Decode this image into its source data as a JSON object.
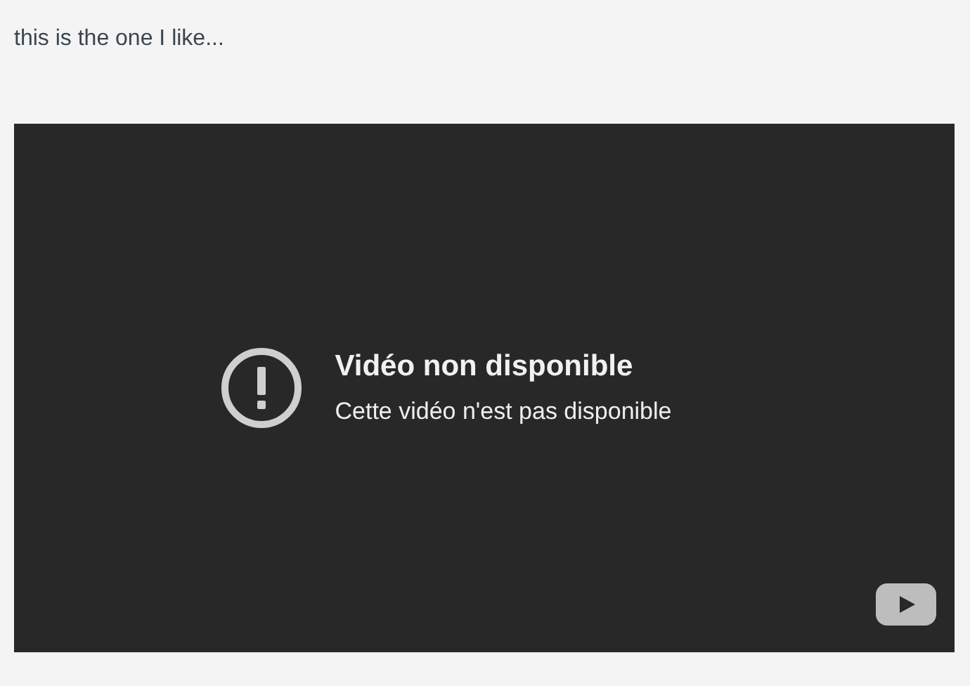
{
  "post": {
    "text": "this is the one I like..."
  },
  "video": {
    "title": "Vidéo non disponible",
    "message": "Cette vidéo n'est pas disponible"
  }
}
